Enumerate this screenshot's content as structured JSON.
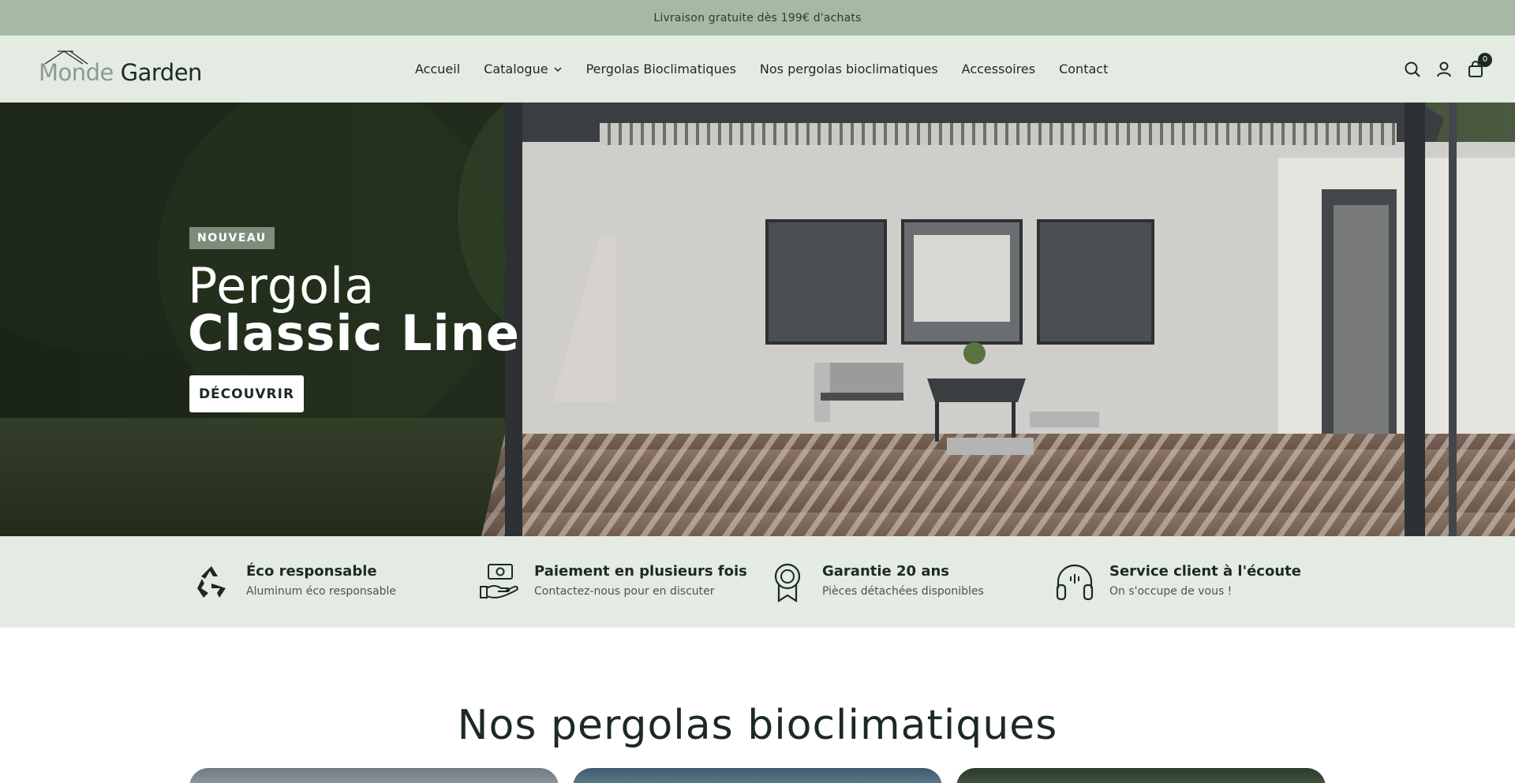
{
  "announcement": {
    "text": "Livraison gratuite dès 199€ d'achats"
  },
  "brand": {
    "name_part1": "Monde",
    "name_part2": " Garden"
  },
  "nav": {
    "items": [
      {
        "label": "Accueil"
      },
      {
        "label": "Catalogue",
        "has_dropdown": true
      },
      {
        "label": "Pergolas Bioclimatiques"
      },
      {
        "label": "Nos pergolas bioclimatiques"
      },
      {
        "label": "Accessoires"
      },
      {
        "label": "Contact"
      }
    ]
  },
  "header_icons": {
    "search": "search-icon",
    "account": "user-icon",
    "cart": "bag-icon",
    "cart_count": "0"
  },
  "hero": {
    "badge": "NOUVEAU",
    "title_line1": "Pergola",
    "title_line2": "Classic Line",
    "cta": "DÉCOUVRIR"
  },
  "features": [
    {
      "icon": "recycle-icon",
      "title": "Éco responsable",
      "subtitle": "Aluminum éco responsable"
    },
    {
      "icon": "money-hand-icon",
      "title": "Paiement en plusieurs fois",
      "subtitle": "Contactez-nous pour en discuter"
    },
    {
      "icon": "award-ribbon-icon",
      "title": "Garantie 20 ans",
      "subtitle": "Pièces détachées disponibles"
    },
    {
      "icon": "headphones-icon",
      "title": "Service client à l'écoute",
      "subtitle": "On s'occupe de vous !"
    }
  ],
  "section": {
    "title": "Nos pergolas bioclimatiques"
  },
  "colors": {
    "announcement_bg": "#a5b9a5",
    "header_bg": "#e3ebe2",
    "badge_bg": "#7c8d7c",
    "text_dark": "#1c2a22"
  }
}
